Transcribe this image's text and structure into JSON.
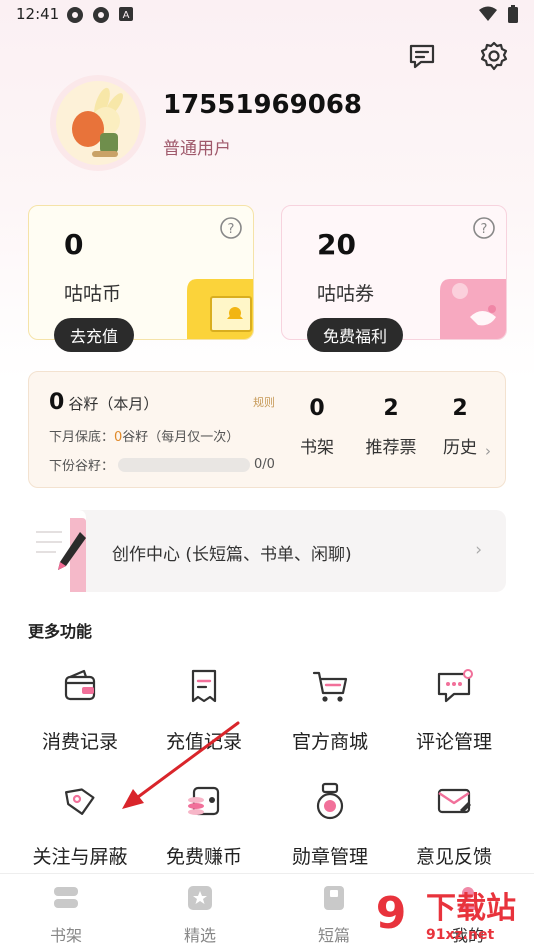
{
  "status_bar": {
    "time": "12:41",
    "left_icons": [
      "settings-icon",
      "settings-icon",
      "a-icon"
    ],
    "right_icons": [
      "wifi-icon",
      "battery-icon"
    ]
  },
  "header": {
    "actions": [
      {
        "icon": "message-icon"
      },
      {
        "icon": "gear-icon"
      }
    ]
  },
  "user": {
    "phone": "17551969068",
    "level": "普通用户"
  },
  "wallet": {
    "coins": {
      "value": "0",
      "label": "咕咕币",
      "button": "去充值"
    },
    "vouchers": {
      "value": "20",
      "label": "咕咕券",
      "button": "免费福利"
    }
  },
  "grain": {
    "value": "0",
    "title_suffix": "谷籽（本月）",
    "rule": "规则",
    "line1_prefix": "下月保底：",
    "line1_highlight": "0",
    "line1_suffix": "谷籽（每月仅一次）",
    "line2_prefix": "下份谷籽：",
    "line2_progress": "0/0",
    "progress_fraction": 0,
    "stats": [
      {
        "value": "0",
        "label": "书架"
      },
      {
        "value": "2",
        "label": "推荐票"
      },
      {
        "value": "2",
        "label": "历史"
      }
    ]
  },
  "create_center": {
    "label": "创作中心 (长短篇、书单、闲聊)",
    "icon": "pen-book-icon"
  },
  "more": {
    "title": "更多功能",
    "items": [
      {
        "label": "消费记录",
        "icon": "wallet-icon"
      },
      {
        "label": "充值记录",
        "icon": "receipt-icon"
      },
      {
        "label": "官方商城",
        "icon": "cart-icon"
      },
      {
        "label": "评论管理",
        "icon": "comment-icon"
      },
      {
        "label": "关注与屏蔽",
        "icon": "tag-icon"
      },
      {
        "label": "免费赚币",
        "icon": "coins-icon"
      },
      {
        "label": "勋章管理",
        "icon": "medal-icon"
      },
      {
        "label": "意见反馈",
        "icon": "feedback-icon"
      }
    ]
  },
  "bottom_nav": [
    {
      "label": "书架",
      "icon": "bookshelf-icon"
    },
    {
      "label": "精选",
      "icon": "star-icon"
    },
    {
      "label": "短篇",
      "icon": "book-icon"
    },
    {
      "label": "我的",
      "icon": "profile-icon"
    }
  ],
  "watermark": {
    "big": "下载站",
    "small": "91xz.net",
    "logo": "9"
  },
  "colors": {
    "accent": "#e95f86",
    "pill": "#2b2b2b",
    "annotation": "#d9252b"
  }
}
